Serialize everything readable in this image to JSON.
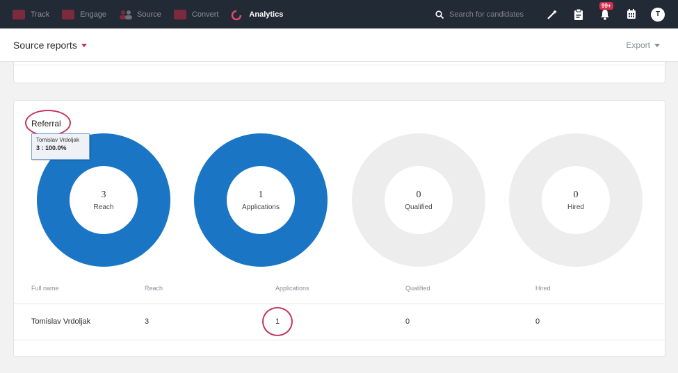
{
  "nav": {
    "items": [
      {
        "label": "Track",
        "icon": "track-icon"
      },
      {
        "label": "Engage",
        "icon": "engage-icon"
      },
      {
        "label": "Source",
        "icon": "source-icon"
      },
      {
        "label": "Convert",
        "icon": "convert-icon"
      },
      {
        "label": "Analytics",
        "icon": "analytics-icon",
        "active": true
      }
    ],
    "search_placeholder": "Search for candidates",
    "notification_badge": "99+",
    "avatar_initial": "T"
  },
  "subheader": {
    "report_label": "Source reports",
    "export_label": "Export"
  },
  "colors": {
    "nav_bg": "#222a36",
    "accent_red": "#d32f4f",
    "donut_blue": "#1a76c4",
    "donut_empty": "#ededed"
  },
  "card": {
    "title": "Referral",
    "tooltip": {
      "name": "Tomislav Vrdoljak",
      "value": "3 : 100.0%"
    },
    "donuts": [
      {
        "value": "3",
        "label": "Reach",
        "fill_fraction": 1.0
      },
      {
        "value": "1",
        "label": "Applications",
        "fill_fraction": 1.0
      },
      {
        "value": "0",
        "label": "Qualified",
        "fill_fraction": 0
      },
      {
        "value": "0",
        "label": "Hired",
        "fill_fraction": 0
      }
    ],
    "table": {
      "headers": [
        "Full name",
        "Reach",
        "Applications",
        "Qualified",
        "Hired"
      ],
      "rows": [
        [
          "Tomislav Vrdoljak",
          "3",
          "1",
          "0",
          "0"
        ]
      ]
    }
  }
}
